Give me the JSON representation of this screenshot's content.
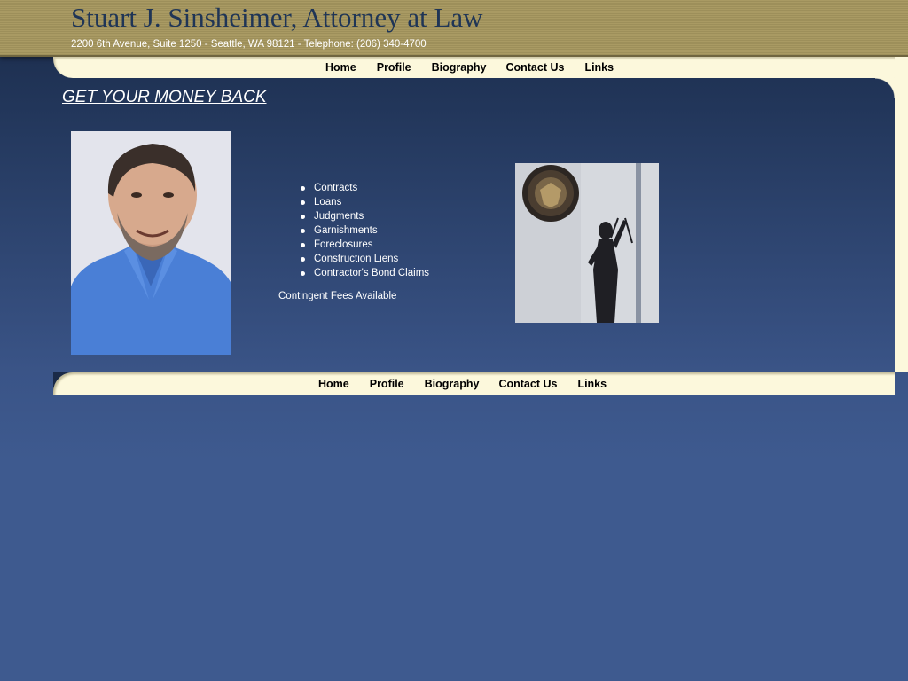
{
  "header": {
    "title": "Stuart J. Sinsheimer, Attorney at Law",
    "address": "2200 6th Avenue, Suite 1250 - Seattle, WA 98121 - Telephone: (206) 340-4700"
  },
  "nav": {
    "items": [
      {
        "label": "Home"
      },
      {
        "label": "Profile"
      },
      {
        "label": "Biography"
      },
      {
        "label": "Contact Us"
      },
      {
        "label": "Links"
      }
    ]
  },
  "main": {
    "headline": "GET YOUR MONEY BACK",
    "services": [
      "Contracts",
      "Loans",
      "Judgments",
      "Garnishments",
      "Foreclosures",
      "Construction Liens",
      "Contractor's Bond Claims"
    ],
    "fees_note": "Contingent Fees Available"
  },
  "colors": {
    "page_background": "#3e5a8f",
    "header_band": "#a99a63",
    "title_text": "#1f3556",
    "nav_background": "#fcf8dc"
  },
  "images": {
    "portrait": "attorney-portrait",
    "justice": "lady-justice-statue-with-seal"
  }
}
